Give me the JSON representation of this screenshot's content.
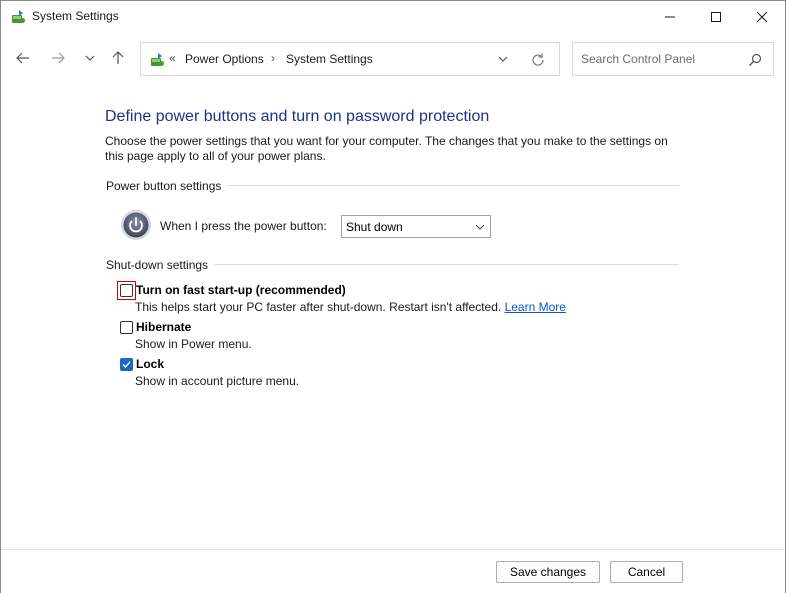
{
  "window": {
    "title": "System Settings",
    "app_icon": "power-options-icon",
    "controls": {
      "minimize": "minimize-icon",
      "maximize": "maximize-icon",
      "close": "close-icon"
    }
  },
  "navigation": {
    "back": "arrow-left-icon",
    "forward": "arrow-right-icon",
    "recent": "chevron-down-icon",
    "up": "arrow-up-icon",
    "breadcrumb": [
      "Power Options",
      "System Settings"
    ],
    "search_placeholder": "Search Control Panel"
  },
  "page": {
    "heading": "Define power buttons and turn on password protection",
    "description": "Choose the power settings that you want for your computer. The changes that you make to the settings on this page apply to all of your power plans.",
    "power_section": {
      "label": "Power button settings",
      "power_button_label": "When I press the power button:",
      "power_button_value": "Shut down"
    },
    "shutdown_section": {
      "label": "Shut-down settings",
      "options": [
        {
          "label": "Turn on fast start-up (recommended)",
          "description": "This helps start your PC faster after shut-down. Restart isn't affected.",
          "link": "Learn More",
          "checked": false
        },
        {
          "label": "Hibernate",
          "description": "Show in Power menu.",
          "checked": false
        },
        {
          "label": "Lock",
          "description": "Show in account picture menu.",
          "checked": true
        }
      ]
    }
  },
  "footer": {
    "save_label": "Save changes",
    "cancel_label": "Cancel"
  },
  "colors": {
    "heading": "#1e3287",
    "link": "#0b57c7",
    "checkbox_checked": "#1868c4",
    "focus_outline": "#d00000"
  }
}
